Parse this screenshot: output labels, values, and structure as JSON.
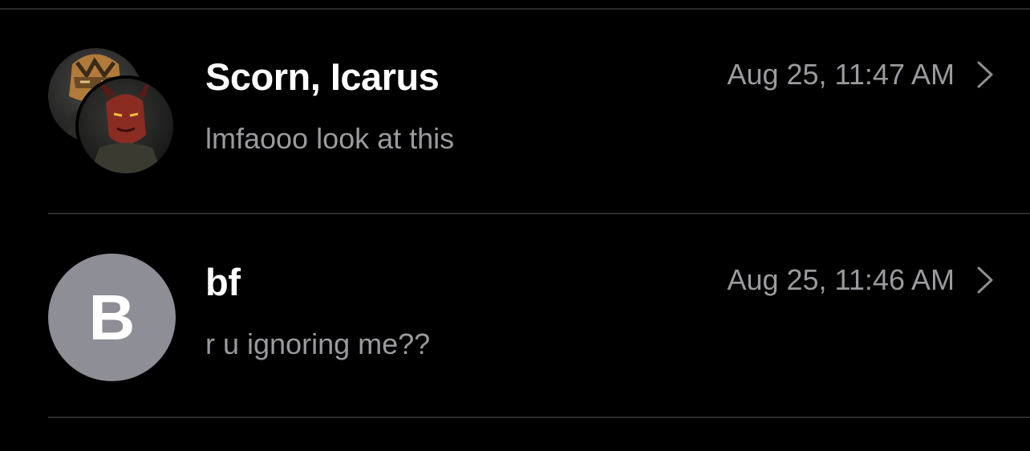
{
  "conversations": [
    {
      "name": "Scorn, Icarus",
      "preview": "lmfaooo look at this",
      "timestamp": "Aug 25, 11:47 AM",
      "avatar_type": "group-photo"
    },
    {
      "name": "bf",
      "preview": "r u ignoring me??",
      "timestamp": "Aug 25, 11:46 AM",
      "avatar_type": "initial",
      "avatar_initial": "B",
      "avatar_color": "#8e8e96"
    }
  ],
  "icons": {
    "disclosure": "chevron-right-icon"
  },
  "colors": {
    "background": "#000000",
    "primary_text": "#ffffff",
    "secondary_text": "#9a9a9f",
    "divider": "#2c2c2e"
  }
}
